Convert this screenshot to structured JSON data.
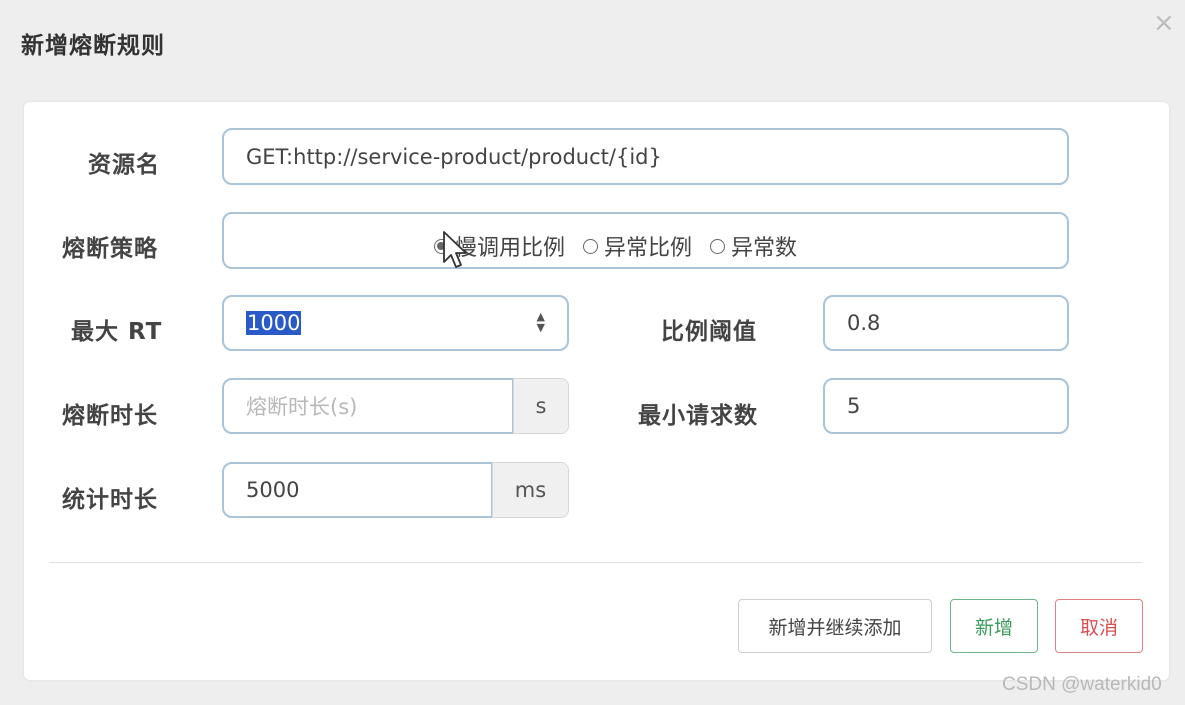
{
  "dialog": {
    "title": "新增熔断规则",
    "close_symbol": "×"
  },
  "form": {
    "resource": {
      "label": "资源名",
      "value": "GET:http://service-product/product/{id}"
    },
    "strategy": {
      "label": "熔断策略",
      "options": [
        "慢调用比例",
        "异常比例",
        "异常数"
      ],
      "selected": "慢调用比例"
    },
    "max_rt": {
      "label": "最大 RT",
      "value": "1000"
    },
    "ratio_threshold": {
      "label": "比例阈值",
      "value": "0.8"
    },
    "break_duration": {
      "label": "熔断时长",
      "placeholder": "熔断时长(s)",
      "unit": "s"
    },
    "min_requests": {
      "label": "最小请求数",
      "value": "5"
    },
    "stat_duration": {
      "label": "统计时长",
      "value": "5000",
      "unit": "ms"
    }
  },
  "buttons": {
    "add_continue": "新增并继续添加",
    "add": "新增",
    "cancel": "取消"
  },
  "watermark": "CSDN @waterkid0",
  "colors": {
    "add_button": "#3a9b5c",
    "cancel_button": "#d85050",
    "input_border": "#a9c3d8",
    "selection": "#2a5ac7"
  }
}
